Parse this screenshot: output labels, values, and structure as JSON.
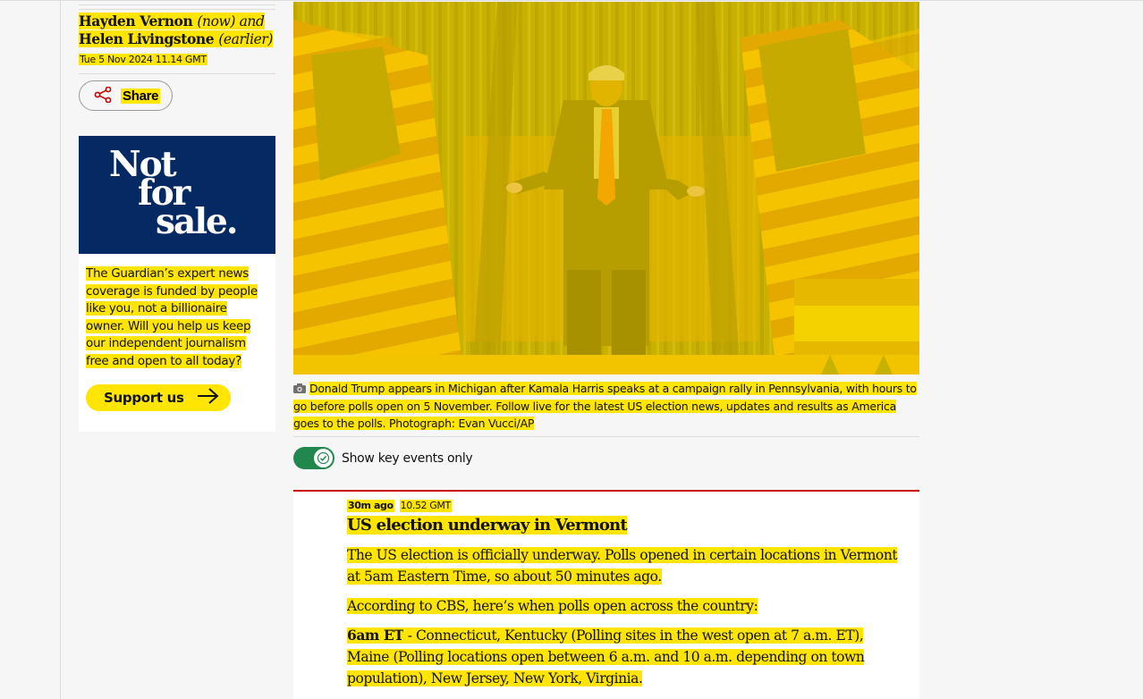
{
  "byline": {
    "author_now": "Hayden Vernon",
    "now_tag": "(now) and",
    "author_earlier": "Helen Livingstone",
    "earlier_tag": "(earlier)",
    "dateline": "Tue 5 Nov 2024 11.14 GMT"
  },
  "share": {
    "label": "Share",
    "icon": "share-icon"
  },
  "promo": {
    "banner_lines": [
      "Not",
      "for",
      "sale."
    ],
    "body": "The Guardian’s expert news coverage is funded by people like you, not a billionaire owner. Will you help us keep our independent journalism free and open to all today?",
    "cta_label": "Support us",
    "cta_icon": "arrow-right-icon",
    "banner_color": "#052962",
    "accent_color": "#ffe500"
  },
  "hero": {
    "alt": "Donald Trump on stage between curtains flanked by US flags",
    "caption_icon": "camera-icon",
    "caption": "Donald Trump appears in Michigan after Kamala Harris speaks at a campaign rally in Pennsylvania, with hours to go before polls open on 5 November. Follow live for the latest US election news, updates and results as America goes to the polls. Photograph: Evan Vucci/AP"
  },
  "key_events_toggle": {
    "label": "Show key events only",
    "checked": true,
    "color": "#22874d"
  },
  "live_block": {
    "relative_time": "30m ago",
    "timestamp": "10.52 GMT",
    "title": "US election underway in Vermont",
    "paragraphs": [
      "The US election is officially underway. Polls opened in certain locations in Vermont at 5am Eastern Time, so about 50 minutes ago.",
      "According to CBS, here’s when polls open across the country:"
    ],
    "schedule": [
      {
        "time": "6am ET",
        "states": " - Connecticut, Kentucky (Polling sites in the west open at 7 a.m. ET), Maine (Polling locations open between 6 a.m. and 10 a.m. depending on town population), New Jersey, New York, Virginia."
      }
    ],
    "border_color": "#c70000"
  }
}
